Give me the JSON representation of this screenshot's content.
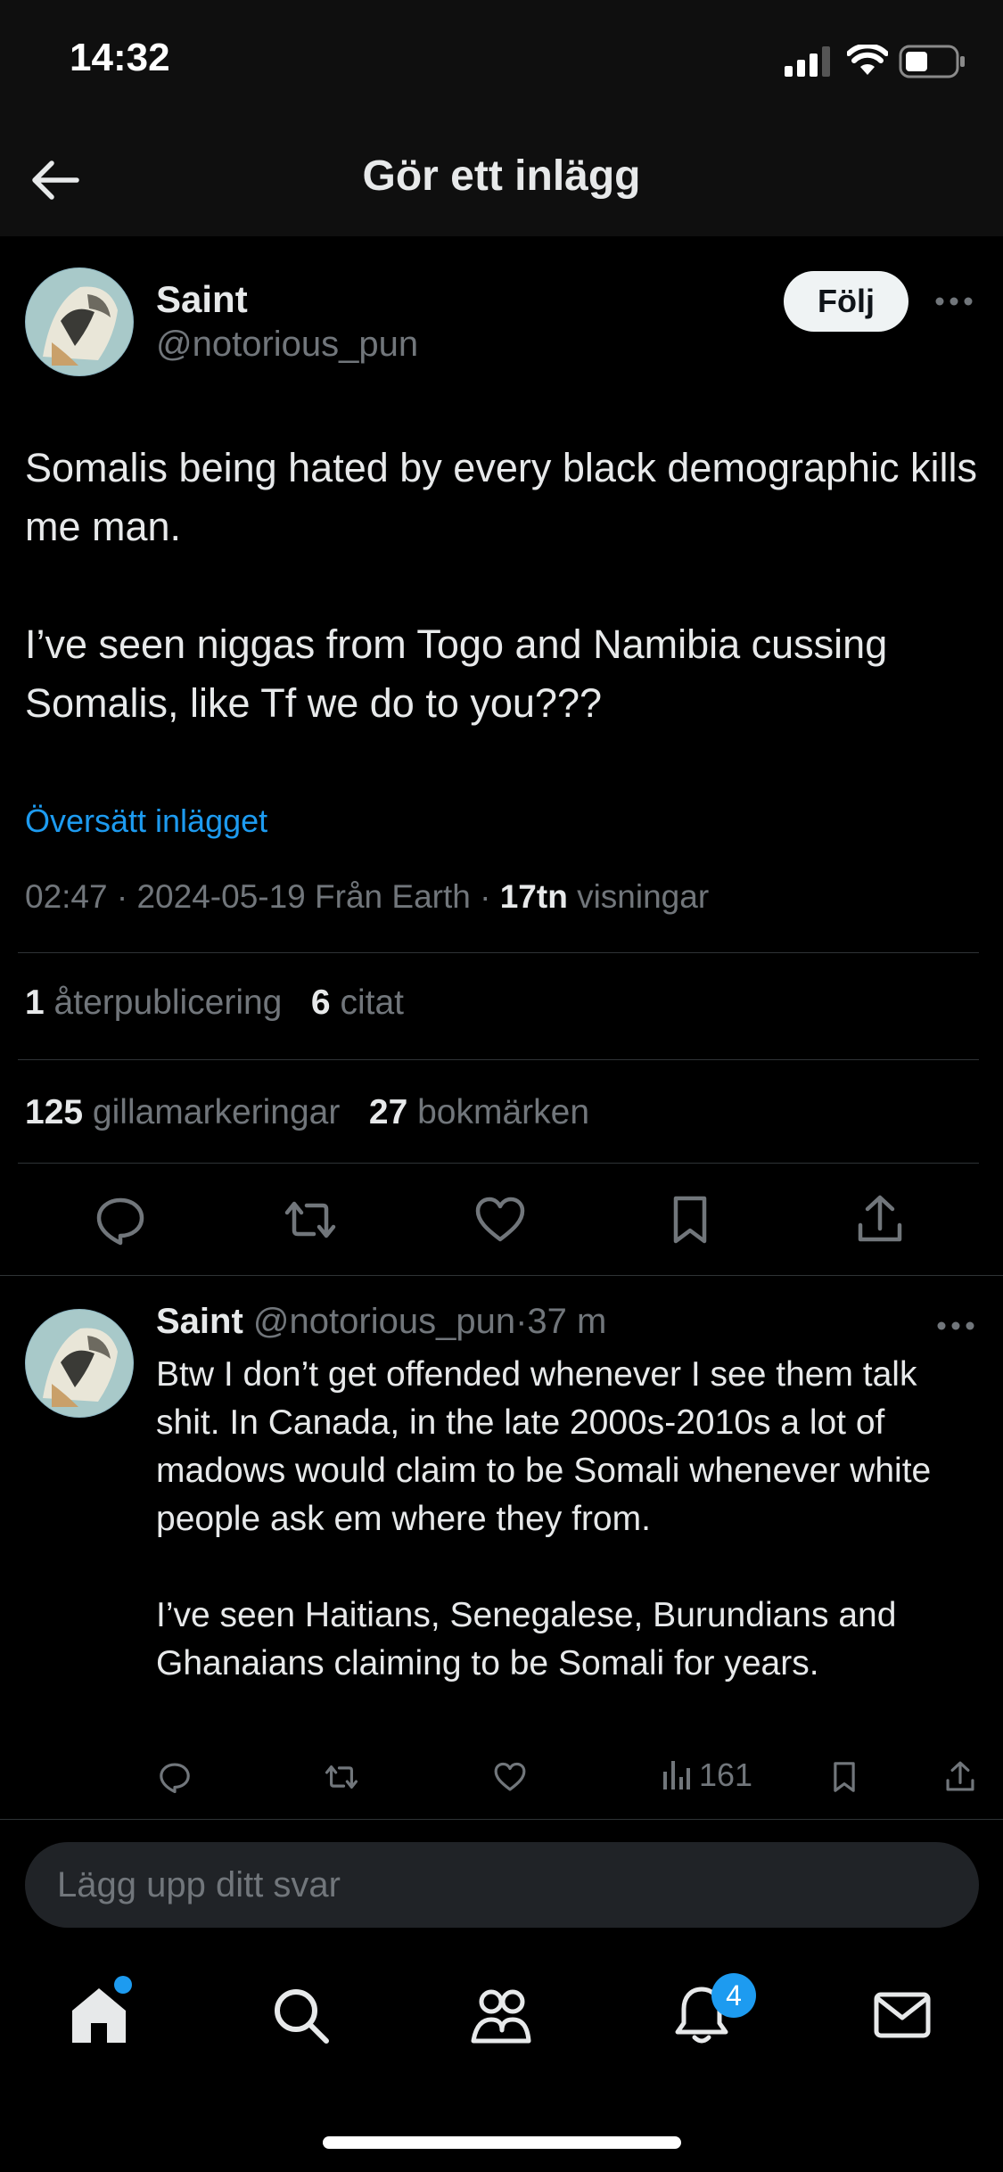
{
  "status_bar": {
    "time": "14:32"
  },
  "header": {
    "title": "Gör ett inlägg"
  },
  "post": {
    "author_name": "Saint",
    "handle": "@notorious_pun",
    "follow_label": "Följ",
    "text": "Somalis being hated by every black demographic kills me man.\n\nI’ve seen niggas from Togo and Namibia cussing Somalis, like Tf we do to you???",
    "translate_label": "Översätt inlägget",
    "time": "02:47",
    "date": "2024-05-19",
    "source": "Från Earth",
    "views_count": "17tn",
    "views_label": "visningar",
    "reposts_count": "1",
    "reposts_label": "återpublicering",
    "quotes_count": "6",
    "quotes_label": "citat",
    "likes_count": "125",
    "likes_label": "gillamarkeringar",
    "bookmarks_count": "27",
    "bookmarks_label": "bokmärken",
    "sep": "·"
  },
  "reply": {
    "author_name": "Saint",
    "handle": "@notorious_pun",
    "age": "37 m",
    "text": "Btw I don’t get offended whenever I see them talk shit. In Canada, in the late 2000s-2010s a lot of madows would claim to be Somali whenever white people ask em where they from.\n\nI’ve seen Haitians, Senegalese, Burundians and Ghanaians claiming to be Somali for years.",
    "views": "161"
  },
  "compose": {
    "placeholder": "Lägg upp ditt svar"
  },
  "tab_bar": {
    "notifications_badge": "4"
  },
  "colors": {
    "accent": "#1d9bf0",
    "background": "#000000",
    "text": "#e7e9ea",
    "muted": "#71767b"
  },
  "icons": [
    "back-arrow-icon",
    "signal-icon",
    "wifi-icon",
    "battery-icon",
    "more-icon",
    "reply-icon",
    "repost-icon",
    "like-icon",
    "bookmark-icon",
    "share-icon",
    "views-icon",
    "home-icon",
    "search-icon",
    "communities-icon",
    "notifications-icon",
    "messages-icon"
  ]
}
